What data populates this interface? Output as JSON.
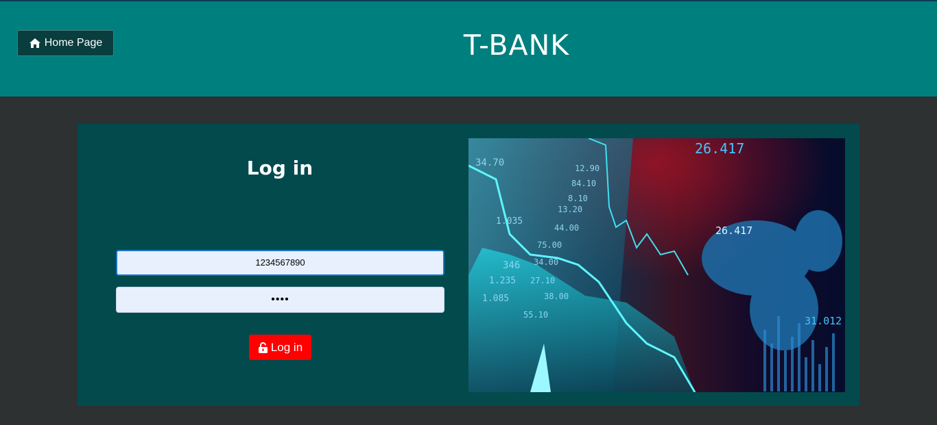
{
  "header": {
    "home_label": "Home Page",
    "brand": "T-BANK",
    "home_icon": "home-icon"
  },
  "login": {
    "title": "Log in",
    "account_value": "1234567890",
    "password_value": "••••",
    "submit_label": "Log in",
    "submit_icon": "unlock-icon"
  },
  "picture": {
    "labels": [
      "26.417",
      "26.417",
      "31.012",
      "34.70",
      "1.035",
      "1.085",
      "1.235",
      "346",
      "27.10",
      "38.00",
      "55.10",
      "34.00",
      "75.00",
      "44.00",
      "13.20",
      "8.10",
      "84.10",
      "12.90"
    ]
  },
  "colors": {
    "header_bg": "#007f7f",
    "page_bg": "#2d3132",
    "panel_bg": "#034a4d",
    "login_button": "#ff0000",
    "field_bg": "#e8f0fe"
  }
}
